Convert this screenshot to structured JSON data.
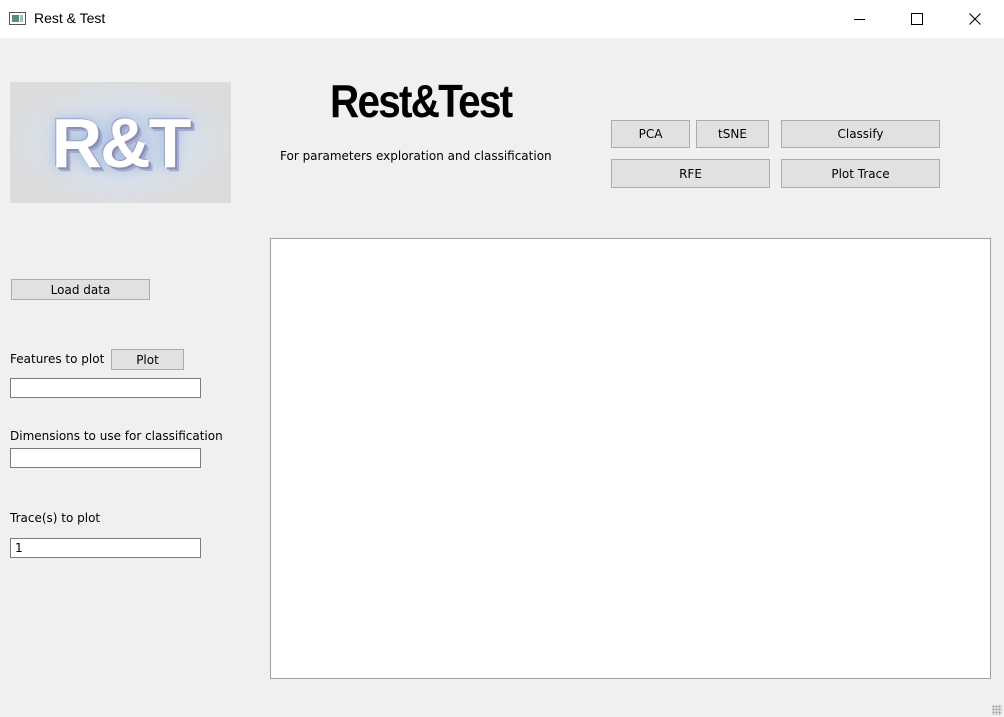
{
  "window": {
    "title": "Rest & Test"
  },
  "logo": {
    "text": "R&T"
  },
  "header": {
    "title": "Rest&Test",
    "subtitle": "For parameters exploration and classification"
  },
  "toolbar": {
    "pca": "PCA",
    "tsne": "tSNE",
    "classify": "Classify",
    "rfe": "RFE",
    "plot_trace": "Plot Trace"
  },
  "left_panel": {
    "load_data": "Load data",
    "features_label": "Features to plot",
    "plot_button": "Plot",
    "features_value": "",
    "dimensions_label": "Dimensions to use for classification",
    "dimensions_value": "",
    "traces_label": "Trace(s) to plot",
    "traces_value": "1"
  }
}
